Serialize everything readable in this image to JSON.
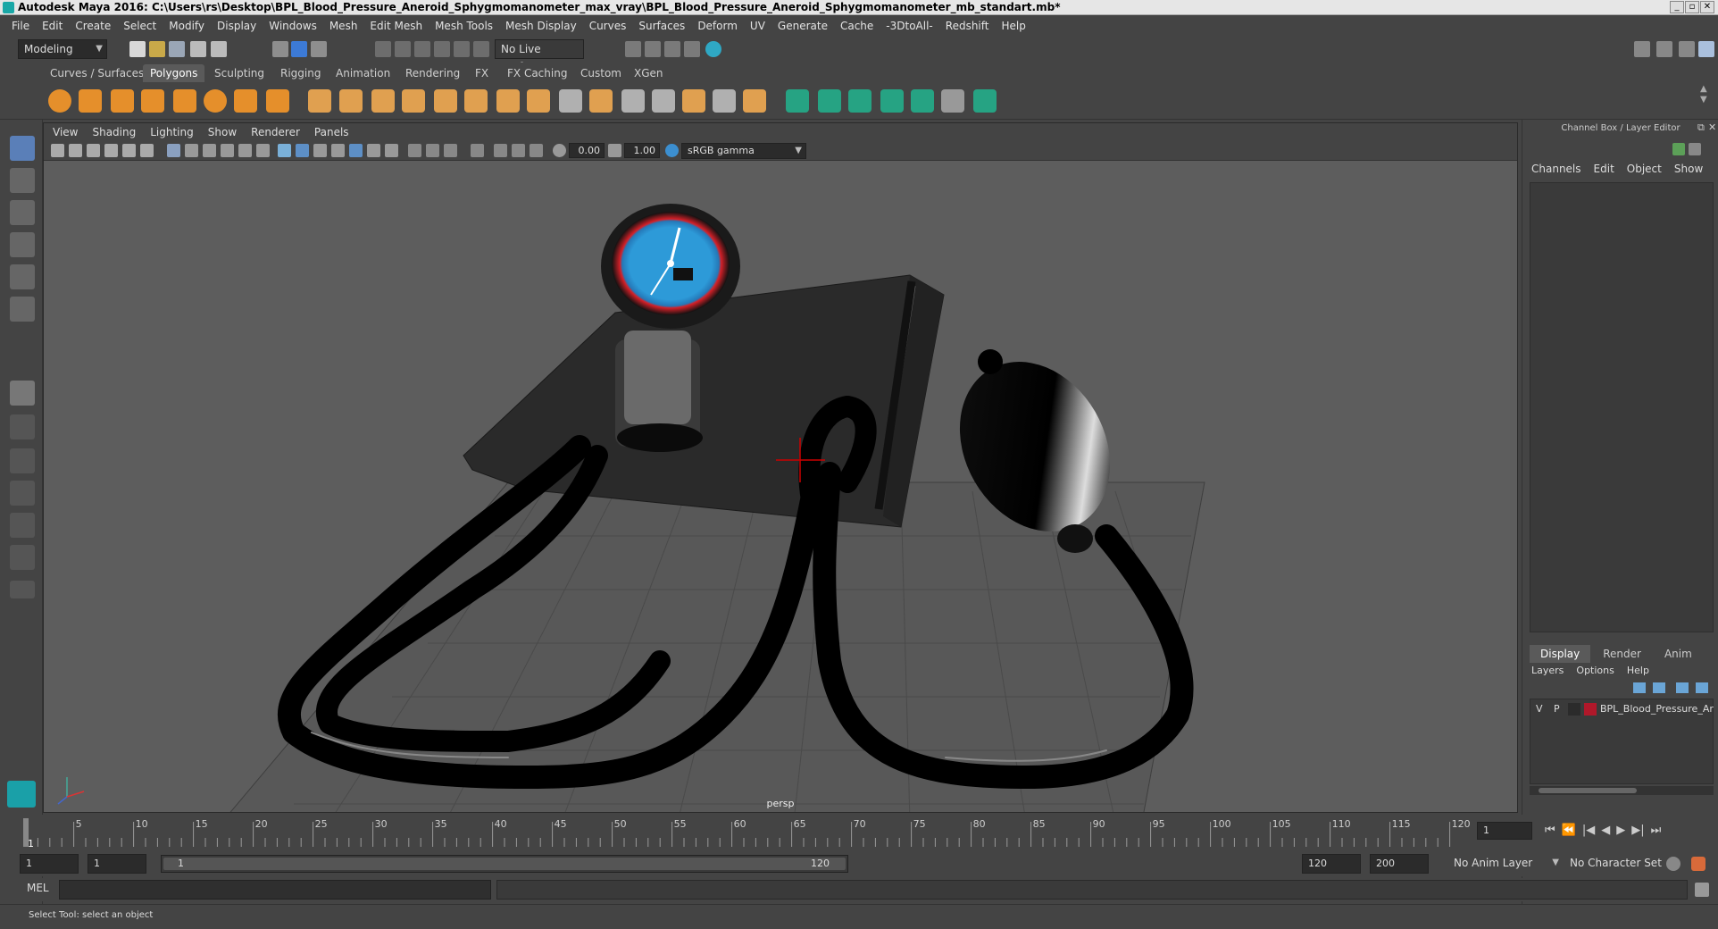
{
  "window": {
    "title": "Autodesk Maya 2016: C:\\Users\\rs\\Desktop\\BPL_Blood_Pressure_Aneroid_Sphygmomanometer_max_vray\\BPL_Blood_Pressure_Aneroid_Sphygmomanometer_mb_standart.mb*"
  },
  "menu": [
    "File",
    "Edit",
    "Create",
    "Select",
    "Modify",
    "Display",
    "Windows",
    "Mesh",
    "Edit Mesh",
    "Mesh Tools",
    "Mesh Display",
    "Curves",
    "Surfaces",
    "Deform",
    "UV",
    "Generate",
    "Cache",
    "-3DtoAll-",
    "Redshift",
    "Help"
  ],
  "status_line": {
    "mode": "Modeling",
    "live_surface": "No Live Surface"
  },
  "shelf_tabs": [
    "Curves / Surfaces",
    "Polygons",
    "Sculpting",
    "Rigging",
    "Animation",
    "Rendering",
    "FX",
    "FX Caching",
    "Custom",
    "XGen"
  ],
  "shelf_active": "Polygons",
  "viewport": {
    "menu": [
      "View",
      "Shading",
      "Lighting",
      "Show",
      "Renderer",
      "Panels"
    ],
    "exposure": "0.00",
    "gamma": "1.00",
    "color_space": "sRGB gamma",
    "camera_label": "persp"
  },
  "channel_box": {
    "title": "Channel Box / Layer Editor",
    "menu": [
      "Channels",
      "Edit",
      "Object",
      "Show"
    ],
    "tabs": [
      "Display",
      "Render",
      "Anim"
    ],
    "layer_menu": [
      "Layers",
      "Options",
      "Help"
    ],
    "layer": {
      "v": "V",
      "p": "P",
      "name": "BPL_Blood_Pressure_Ar",
      "color": "#b0182a"
    }
  },
  "timeline": {
    "ticks": [
      "5",
      "10",
      "15",
      "20",
      "25",
      "30",
      "35",
      "40",
      "45",
      "50",
      "55",
      "60",
      "65",
      "70",
      "75",
      "80",
      "85",
      "90",
      "95",
      "100",
      "105",
      "110",
      "115",
      "120"
    ],
    "start_marker": "1",
    "current_frame": "1"
  },
  "range": {
    "start": "1",
    "playback_start": "1",
    "slider_start": "1",
    "slider_end": "120",
    "playback_end": "120",
    "end": "200",
    "anim_layer": "No Anim Layer",
    "character_set": "No Character Set"
  },
  "command_line": {
    "label": "MEL"
  },
  "help_line": "Select Tool: select an object"
}
